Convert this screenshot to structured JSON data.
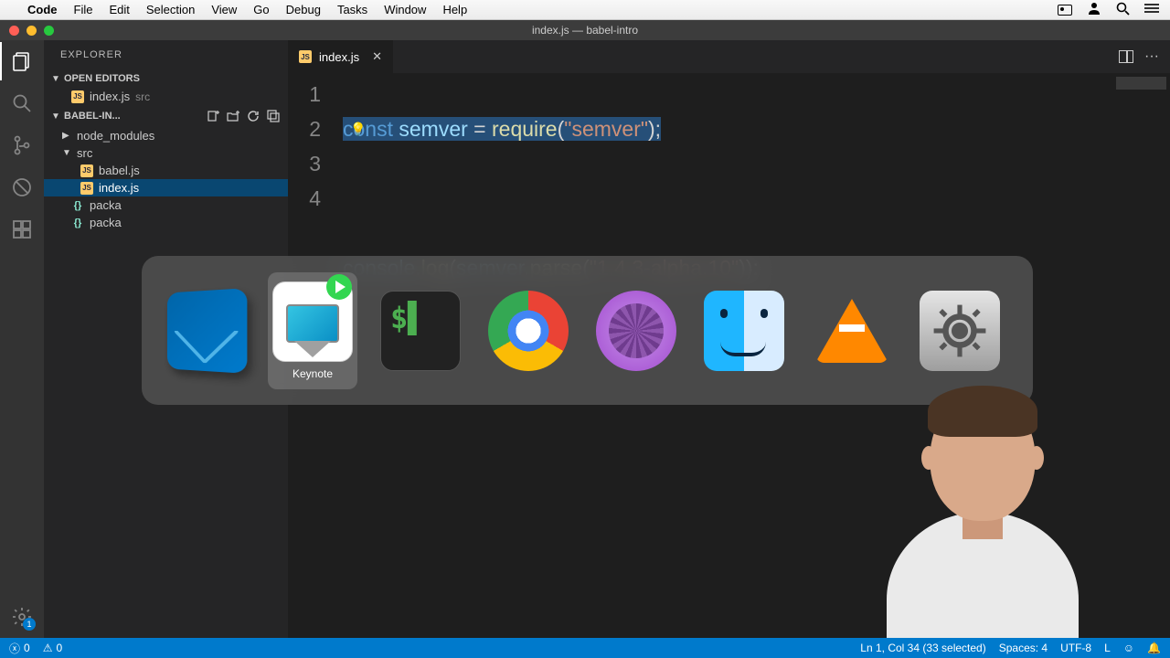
{
  "menubar": {
    "app": "Code",
    "items": [
      "File",
      "Edit",
      "Selection",
      "View",
      "Go",
      "Debug",
      "Tasks",
      "Window",
      "Help"
    ]
  },
  "window": {
    "title": "index.js — babel-intro"
  },
  "sidebar": {
    "title": "EXPLORER",
    "open_editors_label": "OPEN EDITORS",
    "open_file": {
      "name": "index.js",
      "path": "src"
    },
    "project_label": "BABEL-IN...",
    "tree": [
      {
        "kind": "folder",
        "name": "node_modules",
        "expanded": false
      },
      {
        "kind": "folder",
        "name": "src",
        "expanded": true
      },
      {
        "kind": "js",
        "name": "babel.js",
        "indent": 2
      },
      {
        "kind": "js",
        "name": "index.js",
        "indent": 2,
        "selected": true
      },
      {
        "kind": "json",
        "name": "packa",
        "indent": 1
      },
      {
        "kind": "json",
        "name": "packa",
        "indent": 1
      }
    ]
  },
  "tabs": {
    "active": "index.js"
  },
  "code": {
    "lines": [
      "1",
      "2",
      "3",
      "4"
    ],
    "line1": {
      "kw": "const",
      "var": " semver",
      "eq": " = ",
      "fn": "require",
      "p1": "(",
      "str": "\"semver\"",
      "p2": ");"
    },
    "line3": {
      "obj": "console",
      "dot1": ".",
      "fn1": "log",
      "p1": "(",
      "var": "semver",
      "dot2": ".",
      "fn2": "parse",
      "p2": "(",
      "str": "\"1.4.3-alpha.10\"",
      "p3": "));"
    }
  },
  "switcher": {
    "apps": [
      "VS Code",
      "Keynote",
      "Terminal",
      "Chrome",
      "ScreenFlow",
      "Finder",
      "VLC",
      "System Preferences"
    ],
    "selected_label": "Keynote"
  },
  "statusbar": {
    "errors": "0",
    "warnings": "0",
    "cursor": "Ln 1, Col 34 (33 selected)",
    "spaces": "Spaces: 4",
    "encoding": "UTF-8",
    "eol": "L"
  },
  "settings_badge": "1"
}
